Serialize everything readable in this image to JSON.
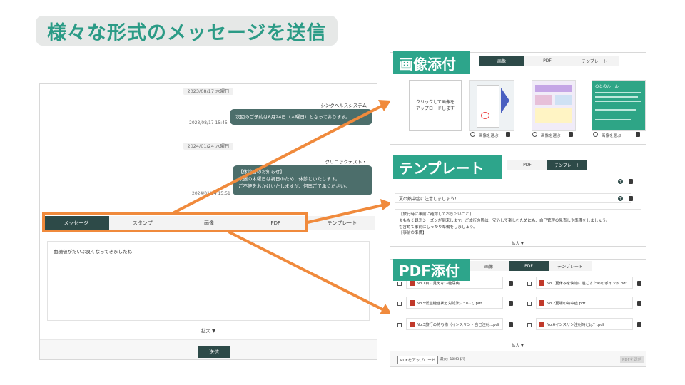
{
  "title": "様々な形式のメッセージを送信",
  "chat": {
    "date1": "2023/08/17 木曜日",
    "sender1": "シンクヘルスシステム",
    "msg1": "次回のご予約は8月24日（木曜日）となっております。",
    "ts1": "2023/08/17 15:45",
    "date2": "2024/01/24 水曜日",
    "sender2": "クリニックテスト・",
    "msg2_lines": [
      "【休診日のお知らせ】",
      "来週の木曜日は祝日のため、休診といたします。",
      "ご不便をおかけいたしますが、何卒ご了承ください。"
    ],
    "ts2": "2024/01/24 15:51"
  },
  "tabs": [
    "メッセージ",
    "スタンプ",
    "画像",
    "PDF",
    "テンプレート"
  ],
  "compose_text": "血糖値がだいぶ良くなってきましたね",
  "expand_label": "拡大 ▼",
  "send_label": "送信",
  "image_panel": {
    "label": "画像添付",
    "tabs": [
      "画像",
      "PDF",
      "テンプレート"
    ],
    "upload_text": [
      "クリックして画像を",
      "アップロードします"
    ],
    "select_label": "画像を選ぶ",
    "thumb3_text": "のとのルール"
  },
  "template_panel": {
    "label": "テンプレート",
    "tabs": [
      "PDF",
      "テンプレート"
    ],
    "row2": "夏の熱中症に注意しましょう！",
    "body_lines": [
      "【旅行時に事前に確認しておきたいこと】",
      "まもなく観光シーズンが到来します。ご旅行の際は、安心して楽しむためにも、自己管理の見直しや準備をしましょう。",
      "も含めて事前にしっかり準備をしましょう。",
      "【事前の準備】"
    ],
    "expand": "拡大 ▼"
  },
  "pdf_panel": {
    "label": "PDF添付",
    "tabs": [
      "画像",
      "PDF",
      "テンプレート"
    ],
    "left": [
      "No.1目に見えない糖尿病",
      "No.5低血糖症状と対処法について.pdf",
      "No.3旅行の持ち物（インスリン・自己注射...pdf"
    ],
    "right": [
      "No.1夏休みを快適に過ごすためのポイント.pdf",
      "No.2夏場の熱中症.pdf",
      "No.6インスリン注射時とは？.pdf"
    ],
    "expand": "拡大 ▼",
    "upload_btn": "PDFをアップロード",
    "upload_note": "最大：10MBまで",
    "send_btn": "PDFを送信"
  },
  "colors": {
    "accent": "#2da58b",
    "dark": "#2d4a48",
    "arrow": "#f08a3c",
    "title": "#2b9b86"
  }
}
